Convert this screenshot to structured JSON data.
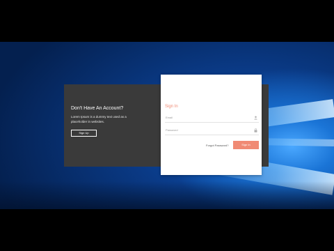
{
  "left_panel": {
    "title": "Don't Have An Account?",
    "text": "Lorem Ipsum is a dummy text used as a placeholder in websites.",
    "signup_label": "Sign Up"
  },
  "signin_card": {
    "title": "Sign In",
    "email_placeholder": "Email",
    "password_placeholder": "Password",
    "forgot_label": "Forgot Password?",
    "signin_label": "Sign In",
    "accent_color": "#f08a74"
  },
  "icons": {
    "email": "user-icon",
    "password": "lock-icon"
  }
}
